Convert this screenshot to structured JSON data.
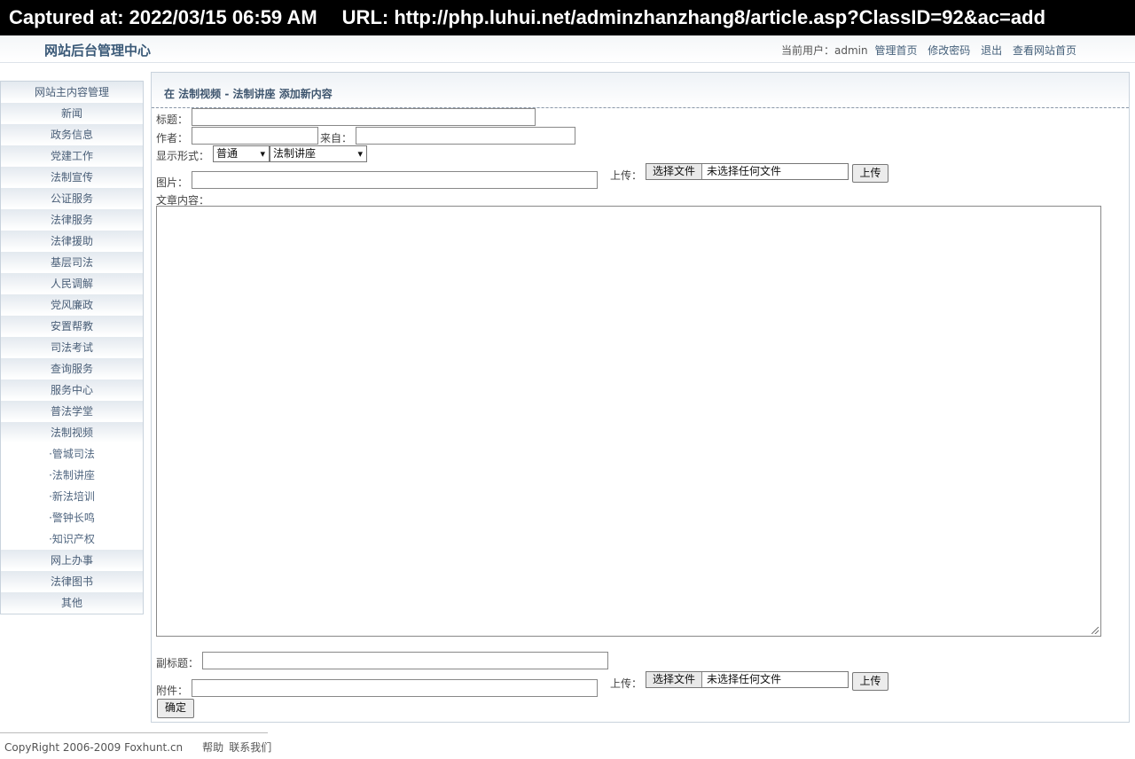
{
  "capture": {
    "time": "Captured at: 2022/03/15 06:59 AM",
    "url": "URL: http://php.luhui.net/adminzhanzhang8/article.asp?ClassID=92&ac=add"
  },
  "header": {
    "title": "网站后台管理中心",
    "current_user": "当前用户：admin",
    "links": [
      "管理首页",
      "修改密码",
      "退出",
      "查看网站首页"
    ]
  },
  "sidebar": {
    "items": [
      {
        "label": "网站主内容管理",
        "type": "head"
      },
      {
        "label": "新闻",
        "type": "cat"
      },
      {
        "label": "政务信息",
        "type": "cat"
      },
      {
        "label": "党建工作",
        "type": "cat"
      },
      {
        "label": "法制宣传",
        "type": "cat"
      },
      {
        "label": "公证服务",
        "type": "cat"
      },
      {
        "label": "法律服务",
        "type": "cat"
      },
      {
        "label": "法律援助",
        "type": "cat"
      },
      {
        "label": "基层司法",
        "type": "cat"
      },
      {
        "label": "人民调解",
        "type": "cat"
      },
      {
        "label": "党风廉政",
        "type": "cat"
      },
      {
        "label": "安置帮教",
        "type": "cat"
      },
      {
        "label": "司法考试",
        "type": "cat"
      },
      {
        "label": "查询服务",
        "type": "cat"
      },
      {
        "label": "服务中心",
        "type": "cat"
      },
      {
        "label": "普法学堂",
        "type": "cat"
      },
      {
        "label": "法制视频",
        "type": "cat"
      },
      {
        "label": "·管城司法",
        "type": "sub"
      },
      {
        "label": "·法制讲座",
        "type": "sub"
      },
      {
        "label": "·新法培训",
        "type": "sub"
      },
      {
        "label": "·警钟长鸣",
        "type": "sub"
      },
      {
        "label": "·知识产权",
        "type": "sub"
      },
      {
        "label": "网上办事",
        "type": "cat"
      },
      {
        "label": "法律图书",
        "type": "cat"
      },
      {
        "label": "其他",
        "type": "cat"
      }
    ]
  },
  "form": {
    "heading": "在 法制视频 - 法制讲座 添加新内容",
    "title_label": "标题：",
    "title_value": "",
    "author_label": "作者：",
    "author_value": "",
    "source_label": "来自：",
    "source_value": "",
    "display_label": "显示形式：",
    "display_selected": "普通",
    "category_selected": "法制讲座",
    "image_label": "图片：",
    "image_value": "",
    "upload_label": "上传：",
    "choose_file": "选择文件",
    "no_file": "未选择任何文件",
    "upload_button": "上传",
    "content_label": "文章内容：",
    "subtitle_label": "副标题：",
    "subtitle_value": "",
    "attachment_label": "附件：",
    "attachment_value": "",
    "submit_button": "确定"
  },
  "footer": {
    "copyright": "CopyRight 2006-2009 Foxhunt.cn",
    "help": "帮助",
    "contact": "联系我们"
  }
}
